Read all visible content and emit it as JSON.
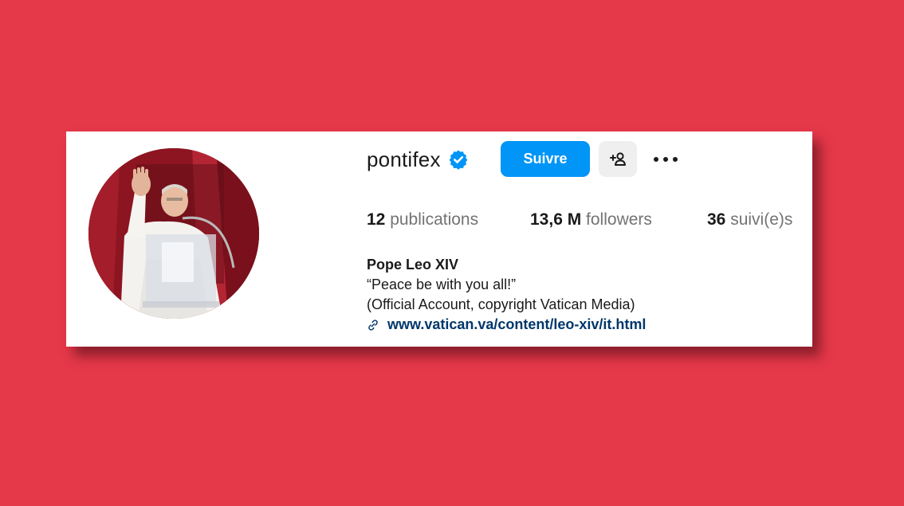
{
  "profile": {
    "username": "pontifex",
    "verified": true,
    "follow_label": "Suivre",
    "stats": {
      "posts_count": "12",
      "posts_label": "publications",
      "followers_count": "13,6 M",
      "followers_label": "followers",
      "following_count": "36",
      "following_label": "suivi(e)s"
    },
    "bio": {
      "name": "Pope Leo XIV",
      "line1": "“Peace be with you all!”",
      "line2": "(Official Account, copyright Vatican Media)",
      "link": "www.vatican.va/content/leo-xiv/it.html"
    }
  },
  "icons": {
    "verified": "verified-badge-icon",
    "suggest": "add-person-icon",
    "more": "more-options-icon",
    "link": "link-icon"
  },
  "colors": {
    "background": "#e53849",
    "accent": "#0095f6",
    "link": "#00376b"
  }
}
